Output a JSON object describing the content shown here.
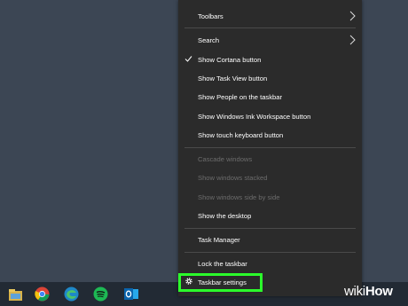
{
  "menu": {
    "items": [
      {
        "label": "Toolbars"
      },
      {
        "label": "Search"
      },
      {
        "label": "Show Cortana button"
      },
      {
        "label": "Show Task View button"
      },
      {
        "label": "Show People on the taskbar"
      },
      {
        "label": "Show Windows Ink Workspace button"
      },
      {
        "label": "Show touch keyboard button"
      },
      {
        "label": "Cascade windows"
      },
      {
        "label": "Show windows stacked"
      },
      {
        "label": "Show windows side by side"
      },
      {
        "label": "Show the desktop"
      },
      {
        "label": "Task Manager"
      },
      {
        "label": "Lock the taskbar"
      },
      {
        "label": "Taskbar settings"
      }
    ]
  },
  "taskbar": {
    "icons": [
      "file-explorer-icon",
      "chrome-icon",
      "edge-icon",
      "spotify-icon",
      "outlook-icon"
    ]
  },
  "watermark": {
    "wiki": "wiki",
    "how": "How"
  },
  "colors": {
    "highlight": "#2bff2b",
    "menu_bg": "#2b2b2b",
    "desktop": "#3c4654"
  }
}
